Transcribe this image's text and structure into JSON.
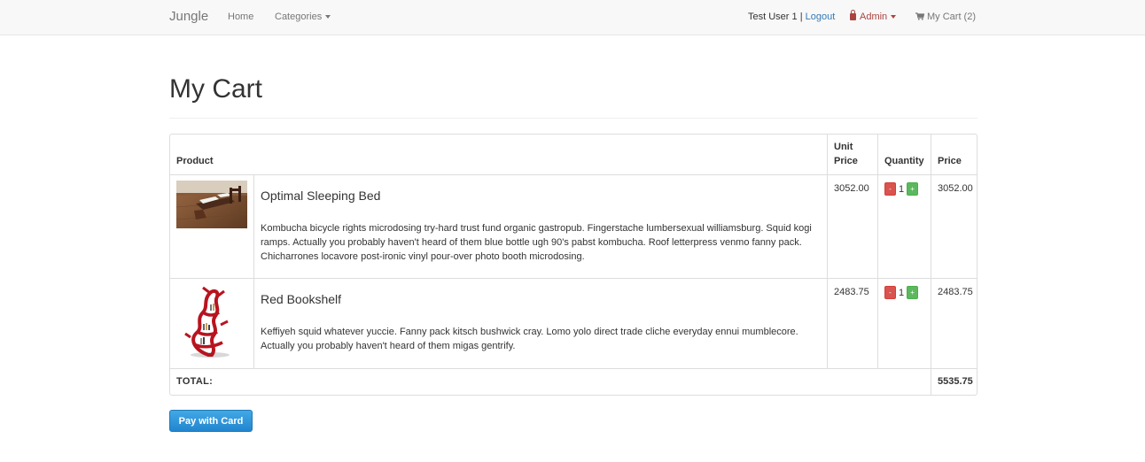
{
  "navbar": {
    "brand": "Jungle",
    "home": "Home",
    "categories": "Categories",
    "user": "Test User 1",
    "separator": "|",
    "logout": "Logout",
    "admin": "Admin",
    "my_cart": "My Cart (2)"
  },
  "page": {
    "title": "My Cart"
  },
  "table": {
    "headers": {
      "product": "Product",
      "unit_price": "Unit Price",
      "quantity": "Quantity",
      "price": "Price"
    },
    "items": [
      {
        "name": "Optimal Sleeping Bed",
        "description": "Kombucha bicycle rights microdosing try-hard trust fund organic gastropub. Fingerstache lumbersexual williamsburg. Squid kogi ramps. Actually you probably haven't heard of them blue bottle ugh 90's pabst kombucha. Roof letterpress venmo fanny pack. Chicharrones locavore post-ironic vinyl pour-over photo booth microdosing.",
        "unit_price": "3052.00",
        "minus": "-",
        "quantity": "1",
        "plus": "+",
        "price": "3052.00"
      },
      {
        "name": "Red Bookshelf",
        "description": "Keffiyeh squid whatever yuccie. Fanny pack kitsch bushwick cray. Lomo yolo direct trade cliche everyday ennui mumblecore. Actually you probably haven't heard of them migas gentrify.",
        "unit_price": "2483.75",
        "minus": "-",
        "quantity": "1",
        "plus": "+",
        "price": "2483.75"
      }
    ],
    "total_label": "TOTAL:",
    "total_value": "5535.75"
  },
  "actions": {
    "pay": "Pay with Card"
  },
  "colors": {
    "link": "#337ab7",
    "admin": "#a94442",
    "minus_btn": "#d9534f",
    "plus_btn": "#5cb85c",
    "pay_btn": "#2186cf"
  }
}
